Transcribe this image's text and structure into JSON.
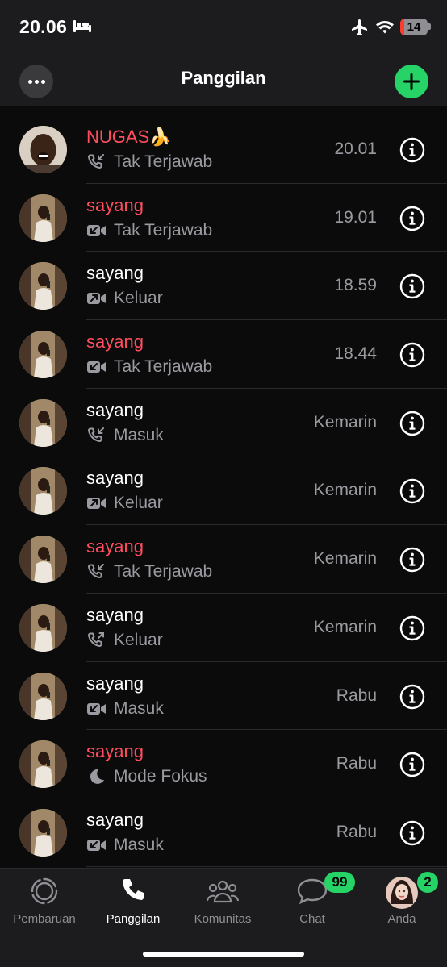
{
  "status_bar": {
    "time": "20.06",
    "battery": "14",
    "battery_level": 0.14
  },
  "header": {
    "title": "Panggilan"
  },
  "calls": [
    {
      "name": "NUGAS🍌",
      "status": "Tak Terjawab",
      "time": "20.01",
      "missed": true,
      "type": "voice-in",
      "avatar": "avatar-nugas"
    },
    {
      "name": "sayang",
      "status": "Tak Terjawab",
      "time": "19.01",
      "missed": true,
      "type": "video-in",
      "avatar": "avatar-sayang"
    },
    {
      "name": "sayang",
      "status": "Keluar",
      "time": "18.59",
      "missed": false,
      "type": "video-out",
      "avatar": "avatar-sayang"
    },
    {
      "name": "sayang",
      "status": "Tak Terjawab",
      "time": "18.44",
      "missed": true,
      "type": "video-in",
      "avatar": "avatar-sayang"
    },
    {
      "name": "sayang",
      "status": "Masuk",
      "time": "Kemarin",
      "missed": false,
      "type": "voice-in",
      "avatar": "avatar-sayang"
    },
    {
      "name": "sayang",
      "status": "Keluar",
      "time": "Kemarin",
      "missed": false,
      "type": "video-out",
      "avatar": "avatar-sayang"
    },
    {
      "name": "sayang",
      "status": "Tak Terjawab",
      "time": "Kemarin",
      "missed": true,
      "type": "voice-in",
      "avatar": "avatar-sayang"
    },
    {
      "name": "sayang",
      "status": "Keluar",
      "time": "Kemarin",
      "missed": false,
      "type": "voice-out",
      "avatar": "avatar-sayang"
    },
    {
      "name": "sayang",
      "status": "Masuk",
      "time": "Rabu",
      "missed": false,
      "type": "video-in",
      "avatar": "avatar-sayang"
    },
    {
      "name": "sayang",
      "status": "Mode Fokus",
      "time": "Rabu",
      "missed": true,
      "type": "focus",
      "avatar": "avatar-sayang"
    },
    {
      "name": "sayang",
      "status": "Masuk",
      "time": "Rabu",
      "missed": false,
      "type": "video-in",
      "avatar": "avatar-sayang"
    }
  ],
  "tabs": [
    {
      "label": "Pembaruan",
      "icon": "updates-icon",
      "active": false,
      "badge": ""
    },
    {
      "label": "Panggilan",
      "icon": "phone-icon",
      "active": true,
      "badge": ""
    },
    {
      "label": "Komunitas",
      "icon": "communities-icon",
      "active": false,
      "badge": ""
    },
    {
      "label": "Chat",
      "icon": "chat-icon",
      "active": false,
      "badge": "99"
    },
    {
      "label": "Anda",
      "icon": "profile-avatar",
      "active": false,
      "badge": "2"
    }
  ],
  "colors": {
    "accent": "#25d366",
    "missed": "#ff4d5e",
    "secondary_text": "#9a9aa0",
    "background": "#0b0b0b",
    "bar": "#1c1c1e"
  }
}
